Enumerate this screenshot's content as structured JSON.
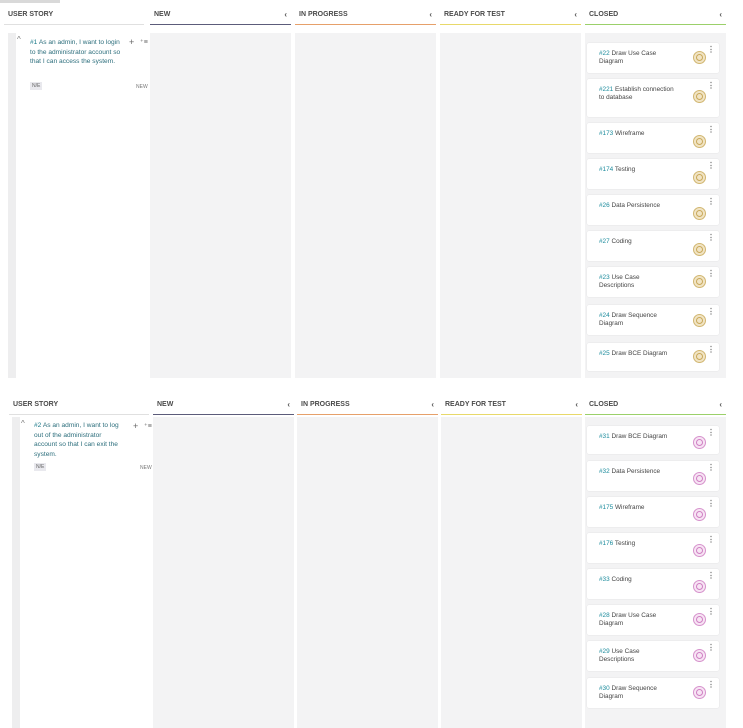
{
  "colors": {
    "new_line": "#5c5c7a",
    "in_progress_line": "#e6a06a",
    "ready_line": "#e8d96a",
    "closed_line": "#9bd06a"
  },
  "columns": {
    "user_story": "USER STORY",
    "new": "NEW",
    "in_progress": "IN PROGRESS",
    "ready_for_test": "READY FOR TEST",
    "closed": "CLOSED",
    "collapse_icon": "chevron-left-icon"
  },
  "rows": [
    {
      "story": {
        "number": "#1",
        "text": "As an admin, I want to login to the administrator account so that I can access the system.",
        "tag": "N/E",
        "status": "NEW"
      },
      "cards": [
        {
          "number": "#22",
          "title": "Draw Use Case Diagram"
        },
        {
          "number": "#221",
          "title": "Establish connection to database"
        },
        {
          "number": "#173",
          "title": "Wireframe"
        },
        {
          "number": "#174",
          "title": "Testing"
        },
        {
          "number": "#26",
          "title": "Data Persistence"
        },
        {
          "number": "#27",
          "title": "Coding"
        },
        {
          "number": "#23",
          "title": "Use Case Descriptions"
        },
        {
          "number": "#24",
          "title": "Draw Sequence Diagram"
        },
        {
          "number": "#25",
          "title": "Draw BCE Diagram"
        }
      ]
    },
    {
      "story": {
        "number": "#2",
        "text": "As an admin, I want to log out of the administrator account so that I can exit the system.",
        "tag": "N/E",
        "status": "NEW"
      },
      "cards": [
        {
          "number": "#31",
          "title": "Draw BCE Diagram"
        },
        {
          "number": "#32",
          "title": "Data Persistence"
        },
        {
          "number": "#175",
          "title": "Wireframe"
        },
        {
          "number": "#176",
          "title": "Testing"
        },
        {
          "number": "#33",
          "title": "Coding"
        },
        {
          "number": "#28",
          "title": "Draw Use Case Diagram"
        },
        {
          "number": "#29",
          "title": "Use Case Descriptions"
        },
        {
          "number": "#30",
          "title": "Draw Sequence Diagram"
        }
      ]
    }
  ]
}
